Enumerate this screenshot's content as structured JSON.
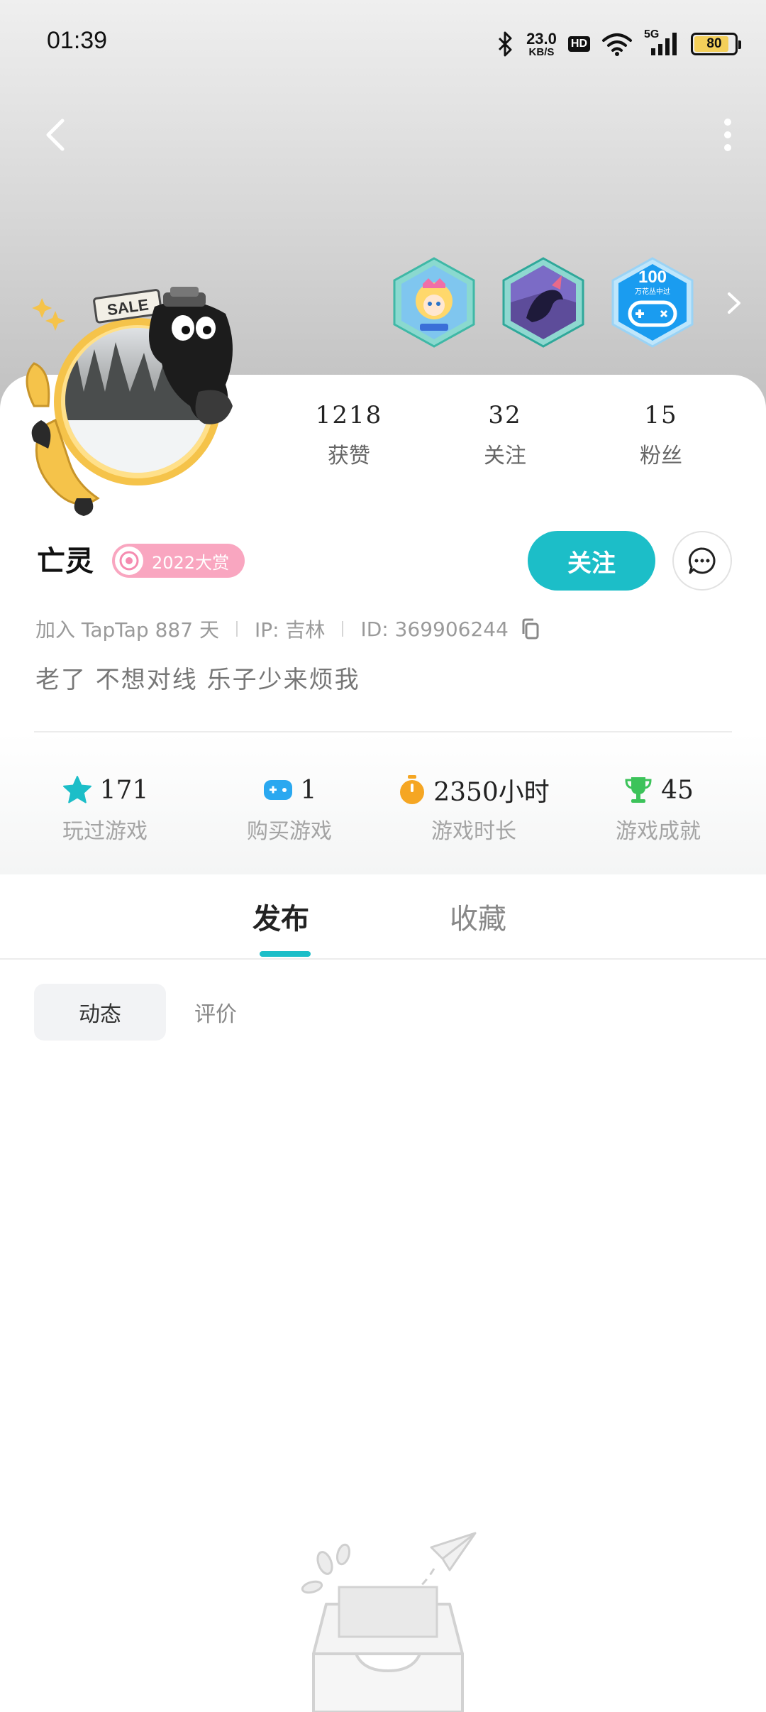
{
  "status_bar": {
    "time": "01:39",
    "net_speed_value": "23.0",
    "net_speed_unit": "KB/S",
    "hd_label": "HD",
    "network": "5G",
    "battery_level": "80"
  },
  "nav": {
    "back_icon": "chevron-left-icon",
    "more_icon": "more-vertical-icon"
  },
  "badges": [
    {
      "name": "anime-girl-badge"
    },
    {
      "name": "dark-creature-badge"
    },
    {
      "name": "100-gamepad-badge",
      "number": "100",
      "caption": "万花丛中过"
    }
  ],
  "avatar": {
    "sale_tag": "SALE"
  },
  "stats": [
    {
      "value": "1218",
      "label": "获赞"
    },
    {
      "value": "32",
      "label": "关注"
    },
    {
      "value": "15",
      "label": "粉丝"
    }
  ],
  "profile": {
    "name": "亡灵",
    "year_badge": "2022大赏",
    "follow_label": "关注",
    "join_text": "加入 TapTap 887 天",
    "ip_text": "IP: 吉林",
    "id_text": "ID: 369906244",
    "bio": "老了 不想对线 乐子少来烦我"
  },
  "game_stats": [
    {
      "icon": "star-icon",
      "value": "171",
      "label": "玩过游戏",
      "color": "#1cbec8"
    },
    {
      "icon": "gamepad-icon",
      "value": "1",
      "label": "购买游戏",
      "color": "#2aa8f0"
    },
    {
      "icon": "stopwatch-icon",
      "value": "2350小时",
      "label": "游戏时长",
      "color": "#f5a623"
    },
    {
      "icon": "trophy-icon",
      "value": "45",
      "label": "游戏成就",
      "color": "#3cc35a"
    }
  ],
  "tabs": {
    "publish": "发布",
    "favorites": "收藏"
  },
  "subtabs": {
    "moments": "动态",
    "reviews": "评价"
  },
  "colors": {
    "accent": "#1cbec8",
    "pink_badge": "#f9a6c0"
  }
}
